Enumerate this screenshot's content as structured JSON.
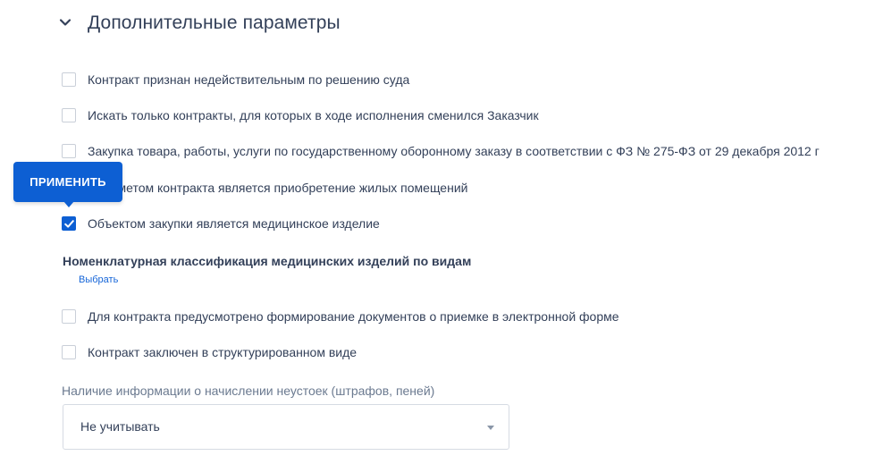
{
  "section": {
    "title": "Дополнительные параметры"
  },
  "checkboxes": [
    {
      "label": "Контракт признан недействительным по решению суда",
      "checked": false
    },
    {
      "label": "Искать только контракты, для которых в ходе исполнения сменился Заказчик",
      "checked": false
    },
    {
      "label": "Закупка товара, работы, услуги по государственному оборонному заказу в соответствии с ФЗ № 275-ФЗ от 29 декабря 2012 г",
      "checked": false
    },
    {
      "label": "Предметом контракта является приобретение жилых помещений",
      "checked": false
    },
    {
      "label": "Объектом закупки является медицинское изделие",
      "checked": true
    }
  ],
  "medical_classification": {
    "title": "Номенклатурная классификация медицинских изделий по видам",
    "link": "Выбрать"
  },
  "checkboxes_2": [
    {
      "label": "Для контракта предусмотрено формирование документов о приемке в электронной форме",
      "checked": false
    },
    {
      "label": "Контракт заключен в структурированном виде",
      "checked": false
    }
  ],
  "penalties": {
    "label": "Наличие информации о начислении неустоек (штрафов, пеней)",
    "selected": "Не учитывать"
  },
  "apply_button": {
    "label": "ПРИМЕНИТЬ"
  },
  "colors": {
    "accent": "#0d5fd3",
    "text": "#334059",
    "muted": "#6b7a90",
    "link": "#1565d8"
  }
}
